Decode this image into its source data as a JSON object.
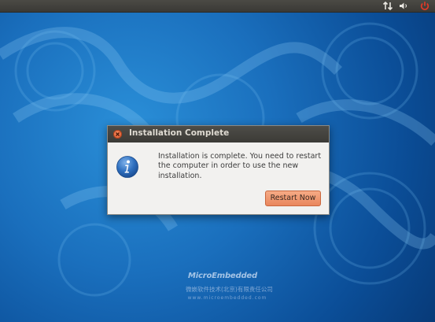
{
  "dialog": {
    "title": "Installation Complete",
    "message": "Installation is complete. You need to restart the computer in order to use the new installation.",
    "restart_button_label": "Restart Now"
  },
  "tray": {
    "icons": [
      "network-icon",
      "volume-icon",
      "power-icon"
    ]
  },
  "watermark": {
    "name": "MicroEmbedded",
    "chinese_name": "微嵌软件技术(北京)有限责任公司",
    "url": "www.microembedded.com"
  },
  "colors": {
    "desktop_blue": "#1a6fbd",
    "titlebar": "#3b3a36",
    "close_button": "#e06a3e",
    "restart_button": "#ee9468",
    "power_icon": "#e03a28"
  }
}
